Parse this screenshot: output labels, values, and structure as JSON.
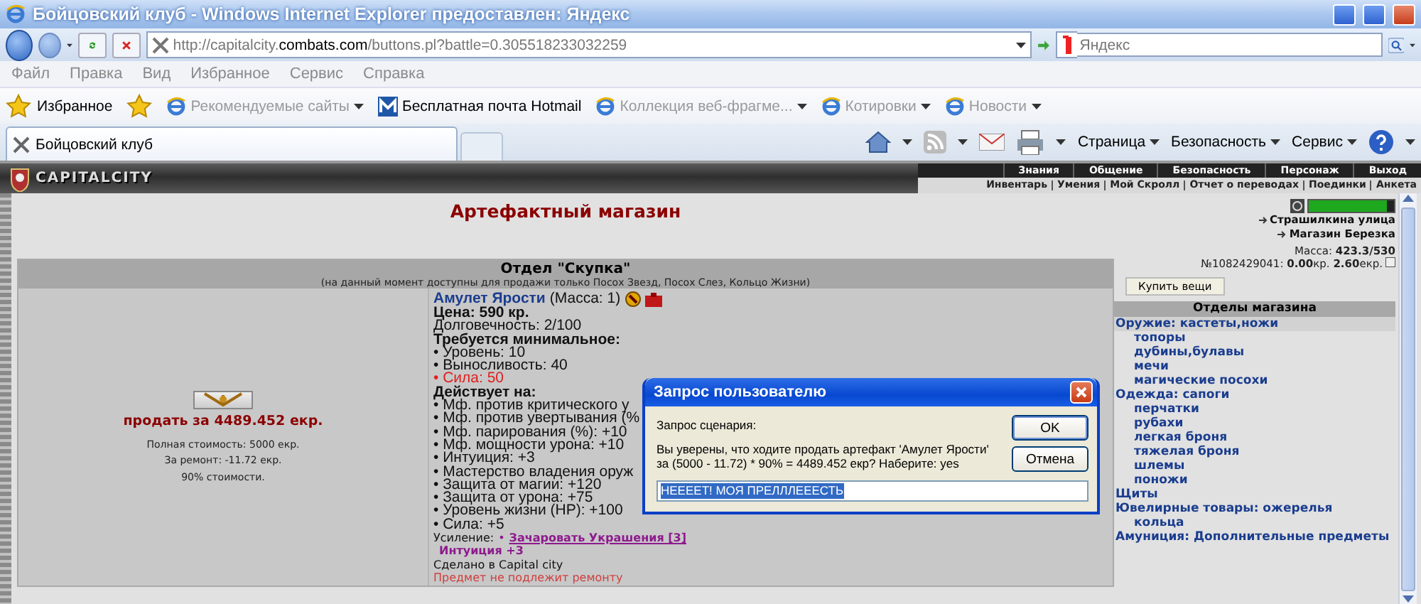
{
  "window": {
    "title": "Бойцовский клуб - Windows Internet Explorer предоставлен: Яндекс"
  },
  "address_bar": {
    "url": "http://capitalcity.**combats.com**/buttons.pl?battle=0.305518233032259"
  },
  "search": {
    "placeholder": "Яндекс"
  },
  "menu": [
    "Файл",
    "Правка",
    "Вид",
    "Избранное",
    "Сервис",
    "Справка"
  ],
  "favorites_bar": {
    "favorites_button": "Избранное",
    "links": [
      {
        "label": "Рекомендуемые сайты",
        "kind": "page",
        "dropdown": true,
        "disabled": true
      },
      {
        "label": "Бесплатная почта Hotmail",
        "kind": "mail",
        "dropdown": false,
        "disabled": false
      },
      {
        "label": "Коллекция веб-фрагме...",
        "kind": "page",
        "dropdown": true,
        "disabled": true
      },
      {
        "label": "Котировки",
        "kind": "page",
        "dropdown": true,
        "disabled": true
      },
      {
        "label": "Новости",
        "kind": "page",
        "dropdown": true,
        "disabled": true
      }
    ]
  },
  "tabs": [
    {
      "label": "Бойцовский клуб",
      "selected": true
    }
  ],
  "command_bar": [
    "Страница",
    "Безопасность",
    "Сервис"
  ],
  "game_header": {
    "logo": "CAPITALCITY",
    "top_menu": [
      "Знания",
      "Общение",
      "Безопасность",
      "Персонаж",
      "Выход"
    ],
    "sub_menu": [
      "Инвентарь",
      "Умения",
      "Мой Скролл",
      "Отчет о переводах",
      "Поединки",
      "Анкета"
    ]
  },
  "shop": {
    "title": "Артефактный магазин",
    "department": {
      "title": "Отдел \"Скупка\"",
      "note": "(на данный момент доступны для продажи только Посох Звезд, Посох Слез, Кольцо Жизни)"
    },
    "sell": {
      "label": "продать за 4489.452 екр.",
      "details": [
        "Полная стоимость: 5000 екр.",
        "За ремонт: -11.72 екр.",
        "90% стоимости."
      ]
    },
    "item": {
      "name": "Амулет Ярости",
      "mass": "(Масса: 1)",
      "lines": [
        {
          "kind": "heading",
          "text": "Цена: 590 кр."
        },
        {
          "kind": "plain",
          "text": "Долговечность: 2/100"
        },
        {
          "kind": "heading",
          "text": "Требуется минимальное:"
        },
        {
          "kind": "bullet",
          "text": "• Уровень: 10"
        },
        {
          "kind": "bullet",
          "text": "• Выносливость: 40"
        },
        {
          "kind": "unmet",
          "text": "• Сила: 50"
        },
        {
          "kind": "heading",
          "text": "Действует на:"
        },
        {
          "kind": "bullet",
          "text": "• Мф. против критического у"
        },
        {
          "kind": "bullet",
          "text": "• Мф. против увертывания (%"
        },
        {
          "kind": "bullet",
          "text": "• Мф. парирования (%): +10"
        },
        {
          "kind": "bullet",
          "text": "• Мф. мощности урона: +10"
        },
        {
          "kind": "bullet",
          "text": "• Интуиция: +3"
        },
        {
          "kind": "bullet",
          "text": "• Мастерство владения оруж"
        },
        {
          "kind": "bullet",
          "text": "• Защита от магии: +120"
        },
        {
          "kind": "bullet",
          "text": "• Защита от урона: +75"
        },
        {
          "kind": "bullet",
          "text": "• Уровень жизни (HP): +100"
        },
        {
          "kind": "bullet",
          "text": "• Сила: +5"
        },
        {
          "kind": "enhancement",
          "text": "Усиление:",
          "marker": "•",
          "link": "Зачаровать Украшения [3]"
        },
        {
          "kind": "bonus",
          "text": "Интуиция +3"
        },
        {
          "kind": "small",
          "text": "Сделано в Capital city"
        },
        {
          "kind": "warning",
          "text": "Предмет не подлежит ремонту"
        }
      ]
    }
  },
  "side": {
    "health": {
      "level": 0.92
    },
    "links": [
      "Страшилкина улица",
      "Магазин Березка"
    ],
    "mass": "Масса: **423.3/530**",
    "money": "№1082429041: **0.00**кр. **2.60**екр.",
    "buy_button": "Купить вещи",
    "departments_title": "Отделы магазина",
    "departments": [
      {
        "label": "Оружие: кастеты,ножи",
        "selected": true,
        "children": [
          {
            "label": "топоры",
            "selected": false
          },
          {
            "label": "дубины,булавы",
            "selected": false
          },
          {
            "label": "мечи",
            "selected": false
          },
          {
            "label": "магические посохи",
            "selected": false
          }
        ]
      },
      {
        "label": "Одежда: сапоги",
        "selected": false,
        "children": [
          {
            "label": "перчатки",
            "selected": false
          },
          {
            "label": "рубахи",
            "selected": false
          },
          {
            "label": "легкая броня",
            "selected": false
          },
          {
            "label": "тяжелая броня",
            "selected": false
          },
          {
            "label": "шлемы",
            "selected": false
          },
          {
            "label": "поножи",
            "selected": false
          }
        ]
      },
      {
        "label": "Щиты",
        "selected": false
      },
      {
        "label": "Ювелирные товары: ожерелья",
        "selected": false,
        "children": [
          {
            "label": "кольца",
            "selected": false
          }
        ]
      },
      {
        "label": "Амуниция: Дополнительные предметы",
        "selected": false
      }
    ]
  },
  "dialog": {
    "title": "Запрос пользователю",
    "label": "Запрос сценария:",
    "message": "Вы уверены, что ходите продать артефакт 'Амулет Ярости' за (5000 - 11.72) * 90% = 4489.452 екр? Наберите: yes",
    "value": "НЕЕЕЕТ! МОЯ ПРЕЛЛЛЕЕЕСТЬ",
    "buttons": [
      {
        "label": "OK",
        "default": true
      },
      {
        "label": "Отмена",
        "default": false
      }
    ]
  }
}
